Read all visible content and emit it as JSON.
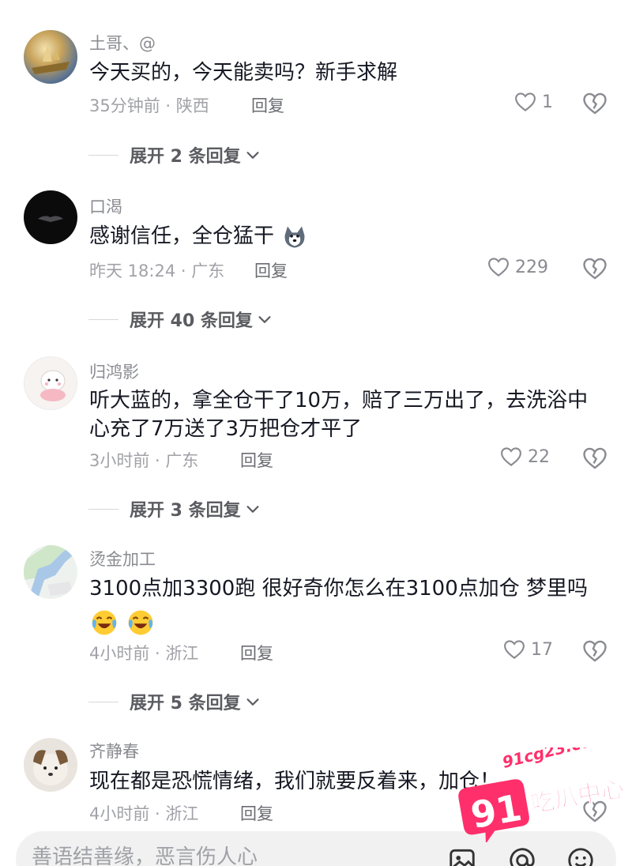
{
  "comments": [
    {
      "username": "土哥、@",
      "text": "今天买的，今天能卖吗？新手求解",
      "meta": "35分钟前 · 陕西",
      "reply": "回复",
      "likes": "1",
      "expand": "展开 2 条回复"
    },
    {
      "username": "口渴",
      "text": "感谢信任，全仓猛干",
      "meta": "昨天 18:24 · 广东",
      "reply": "回复",
      "likes": "229",
      "expand": "展开 40 条回复"
    },
    {
      "username": "归鸿影",
      "text": "听大蓝的，拿全仓干了10万，赔了三万出了，去洗浴中心充了7万送了3万把仓才平了",
      "meta": "3小时前 · 广东",
      "reply": "回复",
      "likes": "22",
      "expand": "展开 3 条回复"
    },
    {
      "username": "烫金加工",
      "text": "3100点加3300跑 很好奇你怎么在3100点加仓 梦里吗",
      "meta": "4小时前 · 浙江",
      "reply": "回复",
      "likes": "17",
      "expand": "展开 5 条回复"
    },
    {
      "username": "齐静春",
      "text": "现在都是恐慌情绪，我们就要反着来，加仓！",
      "meta": "4小时前 · 浙江",
      "reply": "回复"
    }
  ],
  "input": {
    "placeholder": "善语结善缘，恶言伤人心"
  },
  "watermark": {
    "number": "91",
    "domain": "91cg23.com",
    "name": "吃瓜中心"
  },
  "icons": {
    "like": "heart-outline-icon",
    "dislike": "broken-heart-icon",
    "expand": "chevron-down-icon",
    "image": "image-icon",
    "mention": "at-icon",
    "emoji": "smiley-icon"
  }
}
